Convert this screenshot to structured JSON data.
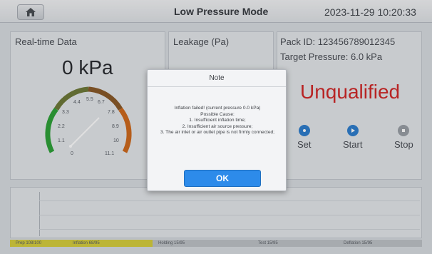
{
  "header": {
    "title": "Low Pressure Mode",
    "datetime": "2023-11-29 10:20:33"
  },
  "realtime": {
    "label": "Real-time Data",
    "value": "0 kPa",
    "gauge_ticks": [
      "0",
      "1.1",
      "2.2",
      "3.3",
      "4.4",
      "5.5",
      "6.7",
      "7.8",
      "8.9",
      "10",
      "11.1"
    ]
  },
  "leakage": {
    "label": "Leakage (Pa)"
  },
  "pack": {
    "pack_id": "Pack ID: 123456789012345",
    "target": "Target Pressure: 6.0 kPa",
    "result": "Unqualified",
    "result_color": "#d22a2a"
  },
  "controls": {
    "set_label": "Set",
    "start_label": "Start",
    "stop_label": "Stop"
  },
  "stages": {
    "prep": "Prep 108/100",
    "inflation": "Inflation 68/95",
    "holding": "Holding 15/95",
    "test": "Test 15/95",
    "deflation": "Deflation 15/95"
  },
  "dialog": {
    "title": "Note",
    "line1": "Inflation failed! (current pressure 0.0 kPa)",
    "line2": "Possible Cause:",
    "line3": "1. Insufficient inflation time;",
    "line4": "2. Insufficient air source pressure;",
    "line5": "3. The air inlet or air outlet pipe is not firmly connected;",
    "ok_label": "OK"
  }
}
